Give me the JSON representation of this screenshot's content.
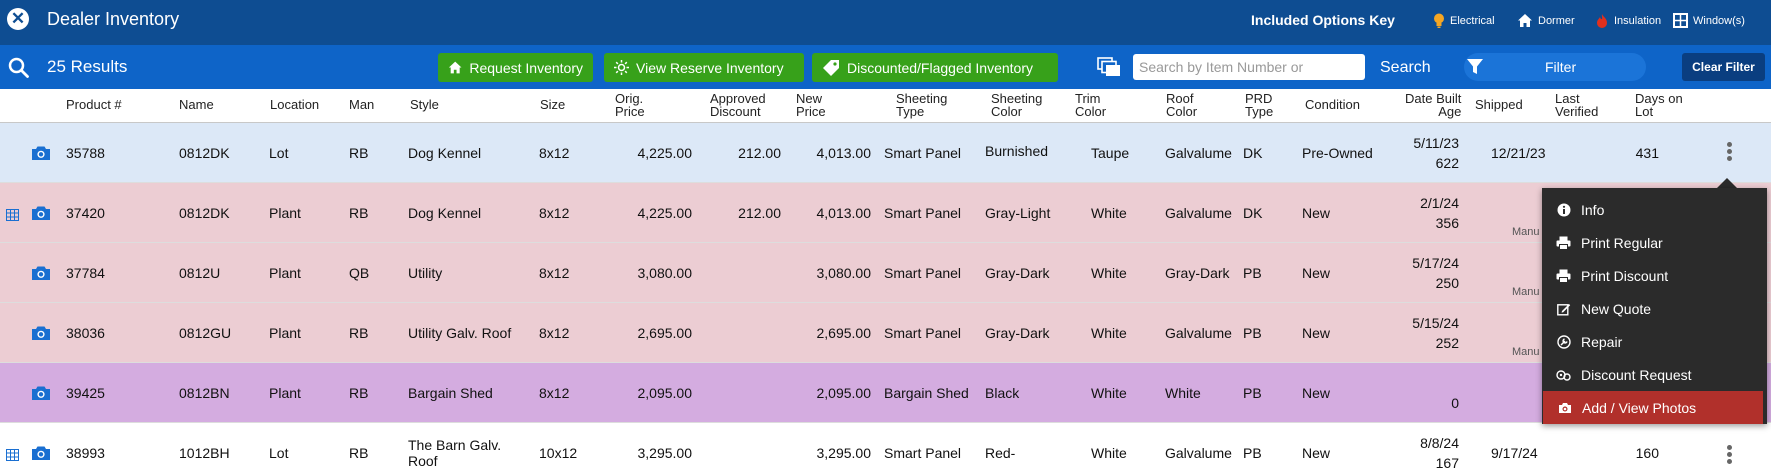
{
  "topbar": {
    "title": "Dealer Inventory",
    "options_key_title": "Included Options Key",
    "options": [
      {
        "label": "Electrical",
        "icon": "lightbulb-icon",
        "color": "#f5a623"
      },
      {
        "label": "Dormer",
        "icon": "house-icon",
        "color": "#ffffff"
      },
      {
        "label": "Insulation",
        "icon": "flame-icon",
        "color": "#e0301e"
      },
      {
        "label": "Window(s)",
        "icon": "window-icon",
        "color": "#ffffff"
      }
    ]
  },
  "toolbar": {
    "results": "25 Results",
    "buttons": [
      "Request Inventory",
      "View Reserve Inventory",
      "Discounted/Flagged Inventory"
    ],
    "search_placeholder": "Search by Item Number or",
    "search_label": "Search",
    "filter_label": "Filter",
    "clear_filter": "Clear Filter"
  },
  "columns": {
    "product": "Product #",
    "name": "Name",
    "location": "Location",
    "man": "Man",
    "style": "Style",
    "size": "Size",
    "orig_price": [
      "Orig.",
      "Price"
    ],
    "approved_discount": [
      "Approved",
      "Discount"
    ],
    "new_price": [
      "New",
      "Price"
    ],
    "sheeting_type": [
      "Sheeting",
      "Type"
    ],
    "sheeting_color": [
      "Sheeting",
      "Color"
    ],
    "trim_color": [
      "Trim",
      "Color"
    ],
    "roof_color": [
      "Roof",
      "Color"
    ],
    "prd_type": [
      "PRD",
      "Type"
    ],
    "condition": "Condition",
    "date_built_age": [
      "Date Built",
      "Age"
    ],
    "shipped": "Shipped",
    "last_verified": [
      "Last",
      "Verified"
    ],
    "days_on_lot": [
      "Days on",
      "Lot"
    ]
  },
  "rows": [
    {
      "product": "35788",
      "name": "0812DK",
      "location": "Lot",
      "man": "RB",
      "style": "Dog Kennel",
      "size": "8x12",
      "orig_price": "4,225.00",
      "discount": "212.00",
      "new_price": "4,013.00",
      "sheeting_type": "Smart Panel",
      "sheeting_color": "Burnished",
      "trim_color": "Taupe",
      "roof_color": "Galvalume",
      "prd_type": "DK",
      "condition": "Pre-Owned",
      "date_built": "5/11/23",
      "age": "622",
      "shipped": "12/21/23",
      "days_on_lot": "431",
      "bg": "#dce8f7"
    },
    {
      "product": "37420",
      "name": "0812DK",
      "location": "Plant",
      "man": "RB",
      "style": "Dog Kennel",
      "size": "8x12",
      "orig_price": "4,225.00",
      "discount": "212.00",
      "new_price": "4,013.00",
      "sheeting_type": "Smart Panel",
      "sheeting_color": "Gray-Light",
      "trim_color": "White",
      "roof_color": "Galvalume",
      "prd_type": "DK",
      "condition": "New",
      "date_built": "2/1/24",
      "age": "356",
      "shipped": "",
      "days_on_lot": "",
      "bg": "#eccdd3",
      "manu": "Manu"
    },
    {
      "product": "37784",
      "name": "0812U",
      "location": "Plant",
      "man": "QB",
      "style": "Utility",
      "size": "8x12",
      "orig_price": "3,080.00",
      "discount": "",
      "new_price": "3,080.00",
      "sheeting_type": "Smart Panel",
      "sheeting_color": "Gray-Dark",
      "trim_color": "White",
      "roof_color": "Gray-Dark",
      "prd_type": "PB",
      "condition": "New",
      "date_built": "5/17/24",
      "age": "250",
      "shipped": "",
      "days_on_lot": "",
      "bg": "#eccdd3",
      "manu": "Manu"
    },
    {
      "product": "38036",
      "name": "0812GU",
      "location": "Plant",
      "man": "RB",
      "style": "Utility Galv. Roof",
      "size": "8x12",
      "orig_price": "2,695.00",
      "discount": "",
      "new_price": "2,695.00",
      "sheeting_type": "Smart Panel",
      "sheeting_color": "Gray-Dark",
      "trim_color": "White",
      "roof_color": "Galvalume",
      "prd_type": "PB",
      "condition": "New",
      "date_built": "5/15/24",
      "age": "252",
      "shipped": "",
      "days_on_lot": "",
      "bg": "#eccdd3",
      "manu": "Manu"
    },
    {
      "product": "39425",
      "name": "0812BN",
      "location": "Plant",
      "man": "RB",
      "style": "Bargain Shed",
      "size": "8x12",
      "orig_price": "2,095.00",
      "discount": "",
      "new_price": "2,095.00",
      "sheeting_type": "Bargain Shed",
      "sheeting_color": "Black",
      "trim_color": "White",
      "roof_color": "White",
      "prd_type": "PB",
      "condition": "New",
      "date_built": "",
      "age": "0",
      "shipped": "",
      "days_on_lot": "",
      "bg": "#d4ace0"
    },
    {
      "product": "38993",
      "name": "1012BH",
      "location": "Lot",
      "man": "RB",
      "style": "The Barn Galv. Roof",
      "size": "10x12",
      "orig_price": "3,295.00",
      "discount": "",
      "new_price": "3,295.00",
      "sheeting_type": "Smart Panel",
      "sheeting_color": "Red-",
      "trim_color": "White",
      "roof_color": "Galvalume",
      "prd_type": "PB",
      "condition": "New",
      "date_built": "8/8/24",
      "age": "167",
      "shipped": "9/17/24",
      "days_on_lot": "160",
      "bg": "#ffffff"
    }
  ],
  "context_menu": {
    "items": [
      {
        "label": "Info",
        "icon": "info-icon"
      },
      {
        "label": "Print Regular",
        "icon": "printer-icon"
      },
      {
        "label": "Print Discount",
        "icon": "printer-icon"
      },
      {
        "label": "New Quote",
        "icon": "edit-icon"
      },
      {
        "label": "Repair",
        "icon": "wrench-icon"
      },
      {
        "label": "Discount Request",
        "icon": "percent-icon"
      },
      {
        "label": "Add / View Photos",
        "icon": "camera-icon"
      }
    ],
    "active_index": 6,
    "active_color": "#b1302b"
  }
}
